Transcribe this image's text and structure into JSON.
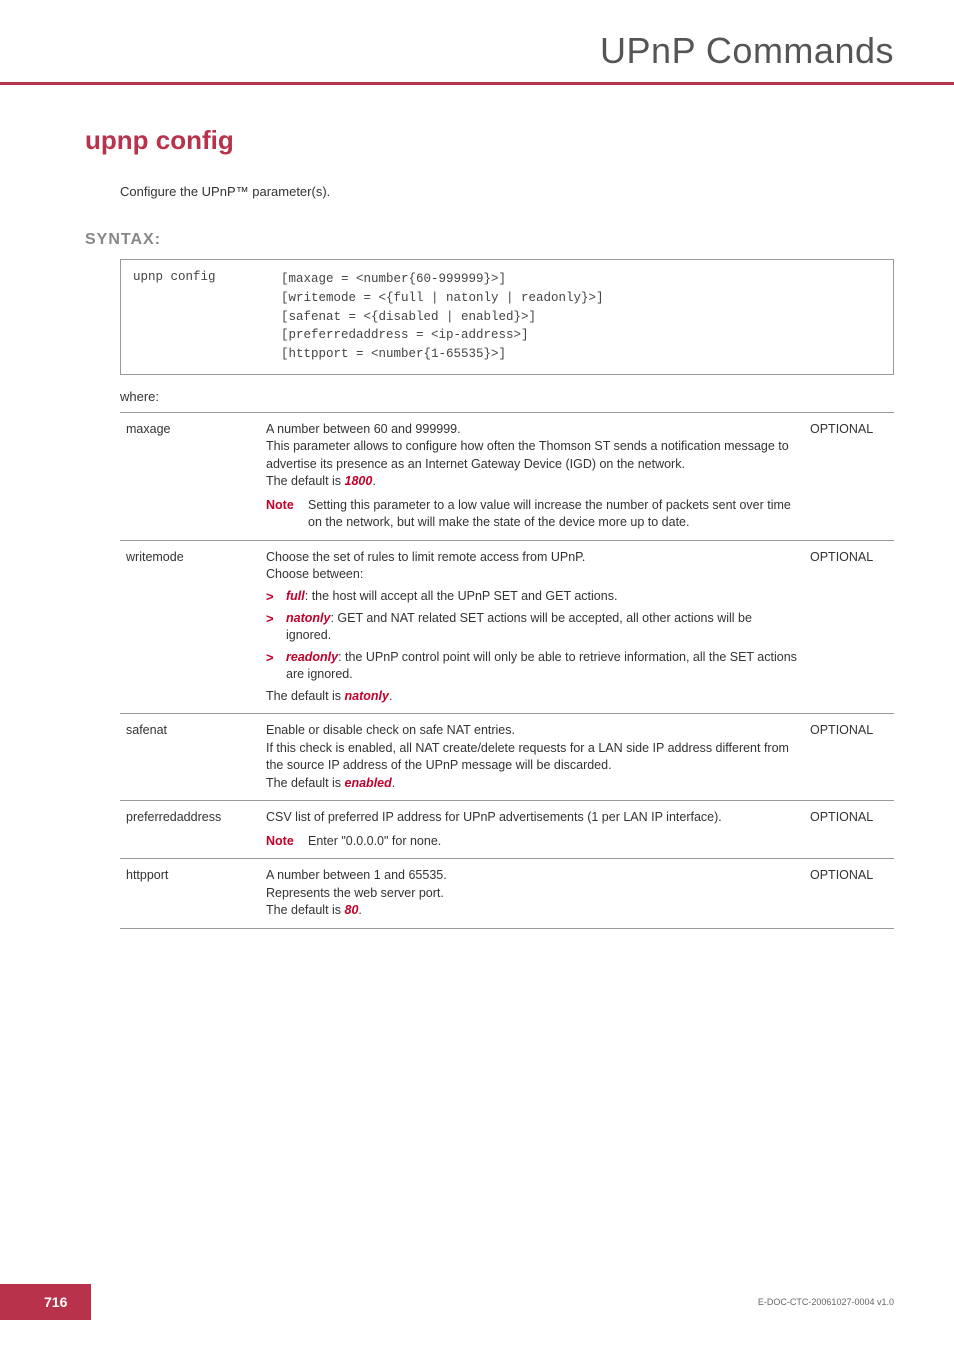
{
  "header": {
    "title": "UPnP Commands"
  },
  "command": {
    "title": "upnp config",
    "description": "Configure the UPnP™ parameter(s)."
  },
  "syntax": {
    "label": "SYNTAX:",
    "cmd": "upnp config",
    "args": "[maxage = <number{60-999999}>]\n[writemode = <{full | natonly | readonly}>]\n[safenat = <{disabled | enabled}>]\n[preferredaddress = <ip-address>]\n[httpport = <number{1-65535}>]"
  },
  "where": "where:",
  "params": [
    {
      "name": "maxage",
      "desc_pre": "A number between 60 and 999999.\nThis parameter allows to configure how often the Thomson ST sends a notification message to advertise its presence as an Internet Gateway Device  (IGD) on the network.\nThe default is ",
      "default": "1800",
      "desc_post": ".",
      "note": "Setting this parameter to a low value will increase the number of packets sent over time on the network, but will make the state of the device more up to date.",
      "flag": "OPTIONAL"
    },
    {
      "name": "writemode",
      "intro": "Choose the set of rules to limit remote access from UPnP.\nChoose between:",
      "bullets": [
        {
          "term": "full",
          "text": ": the host will accept all the UPnP SET and GET actions."
        },
        {
          "term": "natonly",
          "text": ": GET and NAT related SET actions will be accepted, all other actions will be ignored."
        },
        {
          "term": "readonly",
          "text": ": the UPnP control point will only be able to retrieve information, all the SET actions are ignored."
        }
      ],
      "outro_pre": "The default is ",
      "default": "natonly",
      "outro_post": ".",
      "flag": "OPTIONAL"
    },
    {
      "name": "safenat",
      "desc_pre": "Enable or disable check on safe NAT entries.\nIf this check is enabled, all NAT create/delete requests for a LAN side IP address different from the source IP address of the UPnP message will be discarded.\nThe default is ",
      "default": "enabled",
      "desc_post": ".",
      "flag": "OPTIONAL"
    },
    {
      "name": "preferredaddress",
      "desc": "CSV list of preferred IP address for UPnP advertisements (1 per LAN IP interface).",
      "note": "Enter \"0.0.0.0\" for none.",
      "flag": "OPTIONAL"
    },
    {
      "name": "httpport",
      "desc_pre": "A number between 1 and 65535.\nRepresents the web server port.\nThe default is ",
      "default": "80",
      "desc_post": ".",
      "flag": "OPTIONAL"
    }
  ],
  "note_label": "Note",
  "footer": {
    "page": "716",
    "docid": "E-DOC-CTC-20061027-0004 v1.0"
  }
}
